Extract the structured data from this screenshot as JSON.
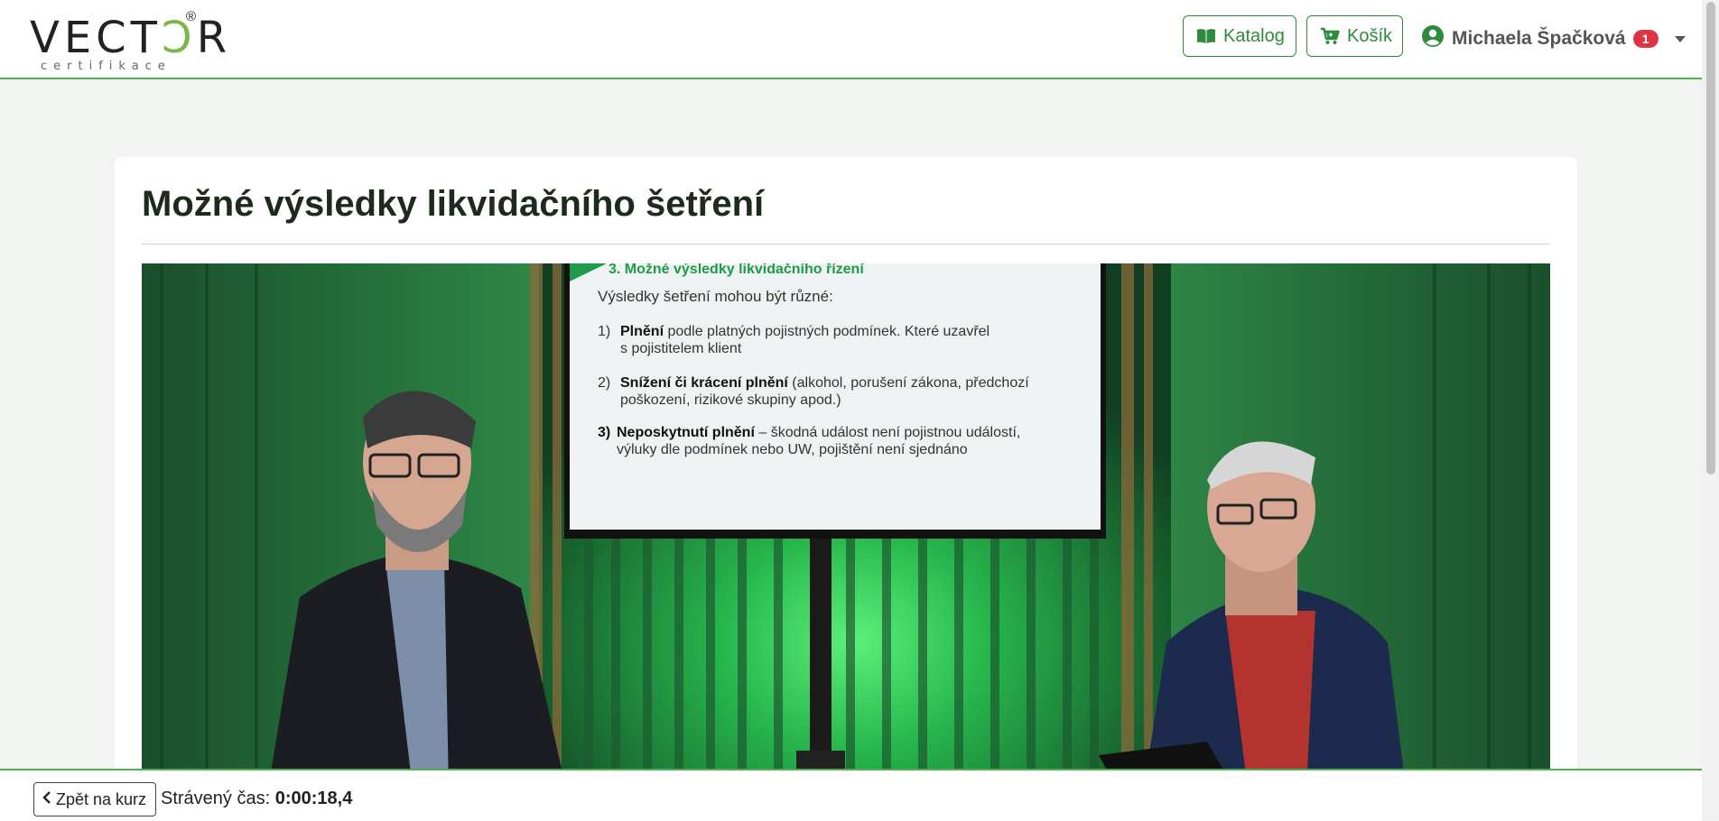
{
  "header": {
    "logo": {
      "text_main": "VECT",
      "text_accent": "Ↄ",
      "text_end": "R",
      "registered": "®",
      "subtitle": "certifikace"
    },
    "catalog_label": "Katalog",
    "cart_label": "Košík",
    "user_name": "Michaela Špačková",
    "notification_count": "1"
  },
  "lesson": {
    "title": "Možné výsledky likvidačního šetření"
  },
  "slide": {
    "heading": "3. Možné výsledky likvidačního řízení",
    "intro": "Výsledky šetření mohou být různé:",
    "items": [
      {
        "num": "1)",
        "bold": "Plnění",
        "rest": " podle platných pojistných podmínek. Které uzavřel",
        "line2": "s pojistitelem klient"
      },
      {
        "num": "2)",
        "bold": "Snížení či krácení plnění",
        "rest": " (alkohol, porušení zákona, předchozí",
        "line2": "poškození, rizikové skupiny apod.)"
      },
      {
        "num": "3)",
        "bold": "Neposkytnutí plnění",
        "rest": " – škodná událost není pojistnou událostí,",
        "line2": "výluky dle podmínek nebo UW, pojištění není sjednáno"
      }
    ]
  },
  "footer": {
    "back_label": "Zpět na kurz",
    "time_label": "Strávený čas:",
    "time_value": "0:00:18,4"
  },
  "colors": {
    "accent": "#2e8b3e",
    "rule": "#4caf50",
    "badge": "#dc3545"
  }
}
